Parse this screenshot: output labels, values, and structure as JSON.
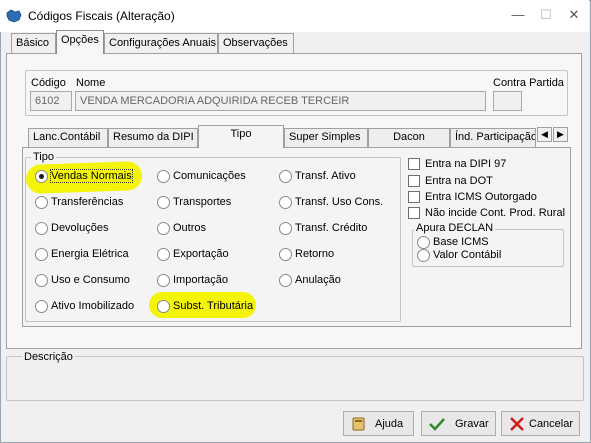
{
  "window": {
    "title": "Códigos Fiscais (Alteração)",
    "controls": {
      "minimize": "—",
      "maximize": "☐",
      "close": "✕"
    }
  },
  "top_tabs": [
    {
      "label": "Básico"
    },
    {
      "label": "Opções",
      "active": true
    },
    {
      "label": "Configurações Anuais"
    },
    {
      "label": "Observações"
    }
  ],
  "header_fields": {
    "codigo_label": "Código",
    "codigo_value": "6102",
    "nome_label": "Nome",
    "nome_value": "VENDA MERCADORIA ADQUIRIDA RECEB TERCEIR",
    "contra_partida_label": "Contra Partida",
    "contra_partida_value": ""
  },
  "sub_tabs": [
    {
      "label": "Lanc.Contábil"
    },
    {
      "label": "Resumo da DIPI"
    },
    {
      "label": "Tipo",
      "active": true
    },
    {
      "label": "Super Simples"
    },
    {
      "label": "Dacon"
    },
    {
      "label": "Índ. Participação"
    }
  ],
  "sub_tab_scroll": {
    "left": "◀",
    "right": "▶"
  },
  "tipo": {
    "label": "Tipo",
    "selected": "Vendas Normais",
    "options": [
      "Vendas Normais",
      "Comunicações",
      "Transf. Ativo",
      "Transferências",
      "Transportes",
      "Transf. Uso Cons.",
      "Devoluções",
      "Outros",
      "Transf. Crédito",
      "Energia Elétrica",
      "Exportação",
      "Retorno",
      "Uso e Consumo",
      "Importação",
      "Anulação",
      "Ativo Imobilizado",
      "Subst. Tributária"
    ]
  },
  "checkboxes": [
    {
      "label": "Entra na DIPI 97",
      "checked": false
    },
    {
      "label": "Entra na DOT",
      "checked": false
    },
    {
      "label": "Entra ICMS Outorgado",
      "checked": false
    },
    {
      "label": "Não incide Cont. Prod. Rural",
      "checked": false
    }
  ],
  "apura_declan": {
    "label": "Apura DECLAN",
    "options": [
      {
        "label": "Base ICMS",
        "checked": false
      },
      {
        "label": "Valor Contábil",
        "checked": false
      }
    ]
  },
  "descricao": {
    "label": "Descrição",
    "value": ""
  },
  "buttons": {
    "ajuda": "Ajuda",
    "gravar": "Gravar",
    "cancelar": "Cancelar"
  },
  "colors": {
    "highlight": "#f4f40a",
    "window_bg": "#f0f0f0",
    "gravar_icon": "#2e8b2e",
    "cancelar_icon": "#d11a1a"
  }
}
